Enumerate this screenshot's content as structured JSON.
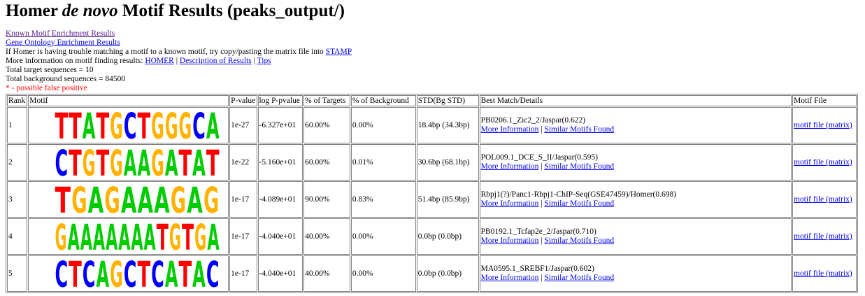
{
  "title": {
    "pre": "Homer ",
    "italic": "de novo",
    "post": " Motif Results (peaks_output/)"
  },
  "links": {
    "known": "Known Motif Enrichment Results",
    "go": "Gene Ontology Enrichment Results",
    "stamp_text": "If Homer is having trouble matching a motif to a known motif, try copy/pasting the matrix file into ",
    "stamp_link": "STAMP",
    "more_info_text": "More information on motif finding results: ",
    "homer": "HOMER",
    "sep": " | ",
    "description": "Description of Results",
    "tips": "Tips"
  },
  "stats": {
    "targets": "Total target sequences = 10",
    "background": "Total background sequences = 84500",
    "false_positive": "* - possible false positive"
  },
  "colors": {
    "A": "#00cc00",
    "C": "#0000ff",
    "G": "#ffb300",
    "T": "#ff0000",
    "link": "#0000ee",
    "visited": "#551a8b",
    "warning": "#ff0000"
  },
  "table": {
    "headers": [
      "Rank",
      "Motif",
      "P-value",
      "log P-pvalue",
      "% of Targets",
      "% of Background",
      "STD(Bg STD)",
      "Best Match/Details",
      "Motif File"
    ],
    "more_info_label": "More Information",
    "similar_label": "Similar Motifs Found",
    "motif_file_label": "motif file (matrix)",
    "rows": [
      {
        "rank": "1",
        "pvalue": "1e-27",
        "logp": "-6.327e+01",
        "targets": "60.00%",
        "background": "0.00%",
        "std": "18.4bp (34.3bp)",
        "best_match": "PB0206.1_Zic2_2/Jaspar(0.622)",
        "logo": "TTATGCTGGGCA"
      },
      {
        "rank": "2",
        "pvalue": "1e-22",
        "logp": "-5.160e+01",
        "targets": "60.00%",
        "background": "0.01%",
        "std": "30.6bp (68.1bp)",
        "best_match": "POL009.1_DCE_S_II/Jaspar(0.595)",
        "logo": "CTGTGAAGATAT"
      },
      {
        "rank": "3",
        "pvalue": "1e-17",
        "logp": "-4.089e+01",
        "targets": "90.00%",
        "background": "0.83%",
        "std": "51.4bp (85.9bp)",
        "best_match": "Rbpj1(?)/Panc1-Rbpj1-ChIP-Seq(GSE47459)/Homer(0.698)",
        "logo": "TGAGAAAGAG"
      },
      {
        "rank": "4",
        "pvalue": "1e-17",
        "logp": "-4.040e+01",
        "targets": "40.00%",
        "background": "0.00%",
        "std": "0.0bp (0.0bp)",
        "best_match": "PB0192.1_Tcfap2e_2/Jaspar(0.710)",
        "logo": "GAAAAAAATGTGA"
      },
      {
        "rank": "5",
        "pvalue": "1e-17",
        "logp": "-4.040e+01",
        "targets": "40.00%",
        "background": "0.00%",
        "std": "0.0bp (0.0bp)",
        "best_match": "MA0595.1_SREBF1/Jaspar(0.602)",
        "logo": "CTCAGCTCATAC"
      }
    ]
  }
}
